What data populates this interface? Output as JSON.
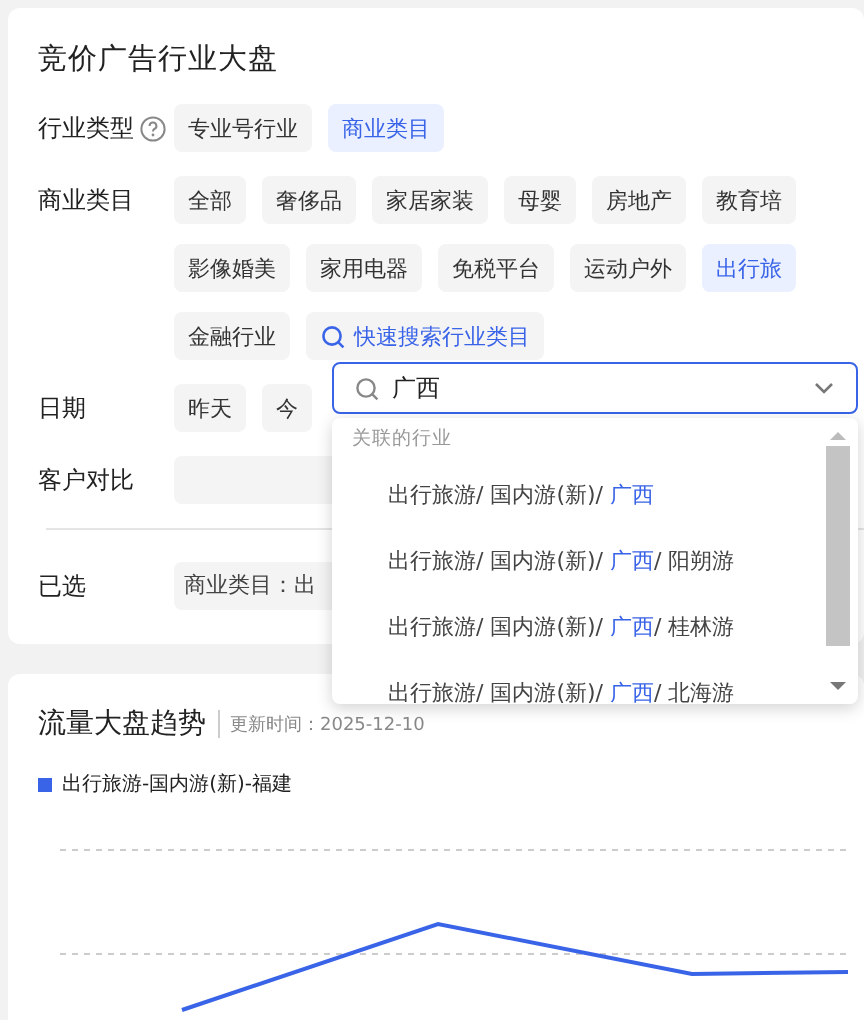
{
  "title": "竞价广告行业大盘",
  "industry_type": {
    "label": "行业类型",
    "options": [
      {
        "text": "专业号行业",
        "selected": false
      },
      {
        "text": "商业类目",
        "selected": true
      }
    ]
  },
  "business_category": {
    "label": "商业类目",
    "options": [
      {
        "text": "全部",
        "selected": false
      },
      {
        "text": "奢侈品",
        "selected": false
      },
      {
        "text": "家居家装",
        "selected": false
      },
      {
        "text": "母婴",
        "selected": false
      },
      {
        "text": "房地产",
        "selected": false
      },
      {
        "text": "教育培",
        "selected": false
      },
      {
        "text": "影像婚美",
        "selected": false
      },
      {
        "text": "家用电器",
        "selected": false
      },
      {
        "text": "免税平台",
        "selected": false
      },
      {
        "text": "运动户外",
        "selected": false
      },
      {
        "text": "出行旅",
        "selected": true
      },
      {
        "text": "金融行业",
        "selected": false
      }
    ],
    "search_link": "快速搜索行业类目"
  },
  "date": {
    "label": "日期",
    "options": [
      {
        "text": "昨天",
        "selected": false
      },
      {
        "text": "今",
        "selected": false
      }
    ]
  },
  "customer_compare": {
    "label": "客户对比"
  },
  "selected_filters": {
    "label": "已选",
    "chips": [
      "商业类目：出"
    ]
  },
  "search_dropdown": {
    "query": "广西",
    "group_label": "关联的行业",
    "results": [
      {
        "prefix": "出行旅游/ 国内游(新)/ ",
        "match": "广西"
      },
      {
        "prefix": "出行旅游/ 国内游(新)/ ",
        "match": "广西",
        "suffix": "/ 阳朔游"
      },
      {
        "prefix": "出行旅游/ 国内游(新)/ ",
        "match": "广西",
        "suffix": "/ 桂林游"
      },
      {
        "prefix": "出行旅游/ 国内游(新)/ ",
        "match": "广西",
        "suffix": "/ 北海游"
      }
    ]
  },
  "trend": {
    "title": "流量大盘趋势",
    "updated": "更新时间：2025-12-10",
    "legend": [
      {
        "name": "出行旅游-国内游(新)-福建",
        "color": "#3a64e8"
      }
    ]
  }
}
